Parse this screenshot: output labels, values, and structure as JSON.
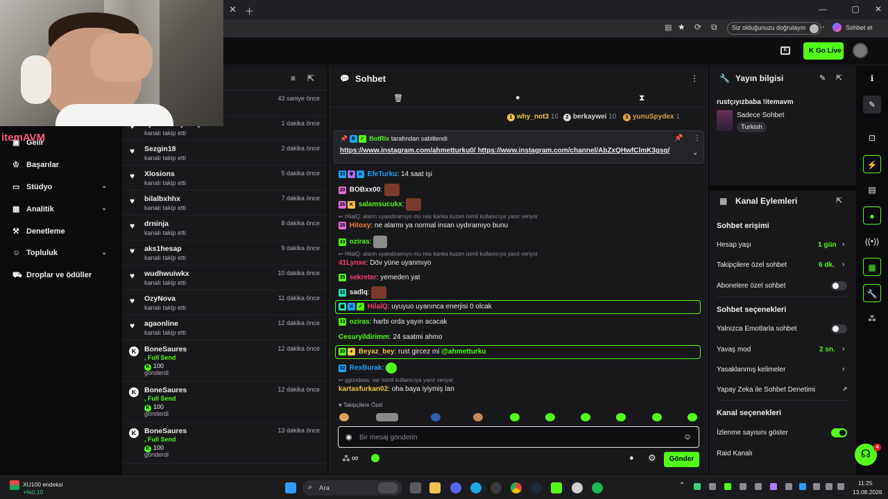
{
  "browser": {
    "verify_label": "Siz olduğunuzu doğrulayın",
    "chat_button_label": "Sohbet et"
  },
  "appbar": {
    "go_live": "Go Live"
  },
  "webcam": {
    "brand_overlay": "itemAVM"
  },
  "leftnav": {
    "items": [
      {
        "label": "Gelir",
        "icon": "revenue-icon"
      },
      {
        "label": "Başarılar",
        "icon": "trophy-icon"
      },
      {
        "label": "Stüdyo",
        "icon": "studio-icon"
      },
      {
        "label": "Analitik",
        "icon": "analytics-icon"
      },
      {
        "label": "Denetleme",
        "icon": "moderation-icon"
      },
      {
        "label": "Topluluk",
        "icon": "community-icon"
      },
      {
        "label": "Droplar ve ödüller",
        "icon": "drops-icon"
      }
    ]
  },
  "feed": {
    "follows": [
      {
        "name": "",
        "sub": "",
        "time": "43 saniye önce"
      },
      {
        "name": "cyburezhayfanly",
        "sub": "kanalı takip etti",
        "time": "1 dakika önce"
      },
      {
        "name": "Sezgin18",
        "sub": "kanalı takip etti",
        "time": "2 dakika önce"
      },
      {
        "name": "Xlosions",
        "sub": "kanalı takip etti",
        "time": "5 dakika önce"
      },
      {
        "name": "bilalbxhhx",
        "sub": "kanalı takip etti",
        "time": "7 dakika önce"
      },
      {
        "name": "drninja",
        "sub": "kanalı takip etti",
        "time": "8 dakika önce"
      },
      {
        "name": "aks1hesap",
        "sub": "kanalı takip etti",
        "time": "9 dakika önce"
      },
      {
        "name": "wudhwuiwkx",
        "sub": "kanalı takip etti",
        "time": "10 dakika önce"
      },
      {
        "name": "OzyNova",
        "sub": "kanalı takip etti",
        "time": "11 dakika önce"
      },
      {
        "name": "agaonline",
        "sub": "kanalı takip etti",
        "time": "12 dakika önce"
      }
    ],
    "gifts": [
      {
        "name": "BoneSaures",
        "tier": ", Full Send",
        "amount": "100",
        "sent": "gönderdi",
        "time": "12 dakika önce"
      },
      {
        "name": "BoneSaures",
        "tier": ", Full Send",
        "amount": "100",
        "sent": "gönderdi",
        "time": "12 dakika önce"
      },
      {
        "name": "BoneSaures",
        "tier": ", Full Send",
        "amount": "100",
        "sent": "gönderdi",
        "time": "13 dakika önce"
      }
    ]
  },
  "chat": {
    "title": "Sohbet",
    "top_chatters": [
      {
        "rank": "1",
        "name": "why_not3",
        "count": "16",
        "color": "#f5c542"
      },
      {
        "rank": "2",
        "name": "berkaywei",
        "count": "10",
        "color": "#d8d8d8"
      },
      {
        "rank": "3",
        "name": "yunuSpydex",
        "count": "1",
        "color": "#e0a24a"
      }
    ],
    "pinned": {
      "author": "BotRix",
      "suffix": "tarafından sabitlendi",
      "link1": "https://www.instagram.com/ahmetturku0/",
      "link2": "https://www.instagram.com/channel/AbZxQHwfClmK3gsq/"
    },
    "messages": [
      {
        "badge": "33",
        "user": "EfeTurku",
        "color": "#1ea4ff",
        "text": ": 14 saat işi"
      },
      {
        "badge": "20",
        "user": "BOBxx00",
        "color": "#efeff1",
        "text": ":"
      },
      {
        "badge": "26",
        "user": "salamsucukx",
        "color": "#53fc18",
        "text": ":"
      },
      {
        "reply": "HilalQ: alarm uyandıramıyo mu reis kanka kuzen isimli kullanıcıya yanıt veriyor"
      },
      {
        "badge": "28",
        "user": "Hitoxy",
        "color": "#ff7a3d",
        "text": ": ne alarmı ya normal insan uydıramıyo bunu"
      },
      {
        "badge": "33",
        "user": "oziras",
        "color": "#53fc18",
        "text": ":"
      },
      {
        "reply": "HilalQ: alarm uyandıramıyo mu reis kanka kuzen isimli kullanıcıya yanıt veriyor"
      },
      {
        "badge": "",
        "user": "41Lynxe",
        "color": "#ff3d6e",
        "text": ": Döv yüne uyanmıyo"
      },
      {
        "badge": "35",
        "user": "sekreter",
        "color": "#ff3d6e",
        "text": ": yemeden yat"
      },
      {
        "badge": "32",
        "user": "sadlq",
        "color": "#efeff1",
        "text": ":"
      },
      {
        "badge": "",
        "user": "HilalQ",
        "color": "#ff3d6e",
        "text": ": uyuyuo uyanınca enerjisi 0 olcak"
      },
      {
        "badge": "33",
        "user": "oziras",
        "color": "#53fc18",
        "text": ": harbi orda yayın acacak"
      },
      {
        "badge": "",
        "user": "Cesuryildirimm",
        "color": "#53fc18",
        "text": ": 24 saatmi ahmo"
      },
      {
        "badge": "30",
        "user": "Beyaz_bey",
        "color": "#f5c542",
        "text": ": rust gircez mi ",
        "mention": "@ahmetturku"
      },
      {
        "badge": "32",
        "user": "RexBurak",
        "color": "#1ea4ff",
        "text": ":"
      },
      {
        "reply": "ggoodaas: var isimli kullanıcıya yanıt veriyor"
      },
      {
        "badge": "",
        "user": "kartasfurkan02",
        "color": "#f5c542",
        "text": ": oha baya iyiymiş lan"
      }
    ],
    "emote_section": "Takipçilere Özel",
    "input_placeholder": "Bir mesaj gönderin",
    "send_label": "Gönder"
  },
  "stream_info": {
    "title": "Yayın bilgisi",
    "stream_title": "rustçıyızbaba !itemavm",
    "category": "Sadece Sohbet",
    "tag": "Turkish"
  },
  "channel_actions": {
    "title": "Kanal Eylemleri",
    "chat_access": "Sohbet erişimi",
    "account_age": {
      "label": "Hesap yaşı",
      "value": "1 gün"
    },
    "followers_only": {
      "label": "Takipçilere özel sohbet",
      "value": "6 dk."
    },
    "subscribers_only": {
      "label": "Abonelere özel sohbet",
      "on": false
    },
    "chat_options": "Sohbet seçenekleri",
    "emote_only": {
      "label": "Yalnızca Emotlarla sohbet",
      "on": false
    },
    "slow_mode": {
      "label": "Yavaş mod",
      "value": "2 sn."
    },
    "banned_words": {
      "label": "Yasaklanmış kelimeler"
    },
    "ai_moderation": {
      "label": "Yapay Zeka ile Sohbet Denetimi"
    },
    "channel_options": "Kanal seçenekleri",
    "show_viewers": {
      "label": "İzlenme sayısını göster",
      "on": true
    },
    "raid": {
      "label": "Raid Kanalı"
    }
  },
  "help_badge": "4",
  "taskbar": {
    "ticker_name": "XU100 endeksi",
    "ticker_change": "+%0,10",
    "search_placeholder": "Ara",
    "time": "11:25",
    "date": "13.08.2026"
  },
  "colors": {
    "accent": "#53fc18",
    "panel": "#18181b",
    "background": "#0b0b0d"
  }
}
